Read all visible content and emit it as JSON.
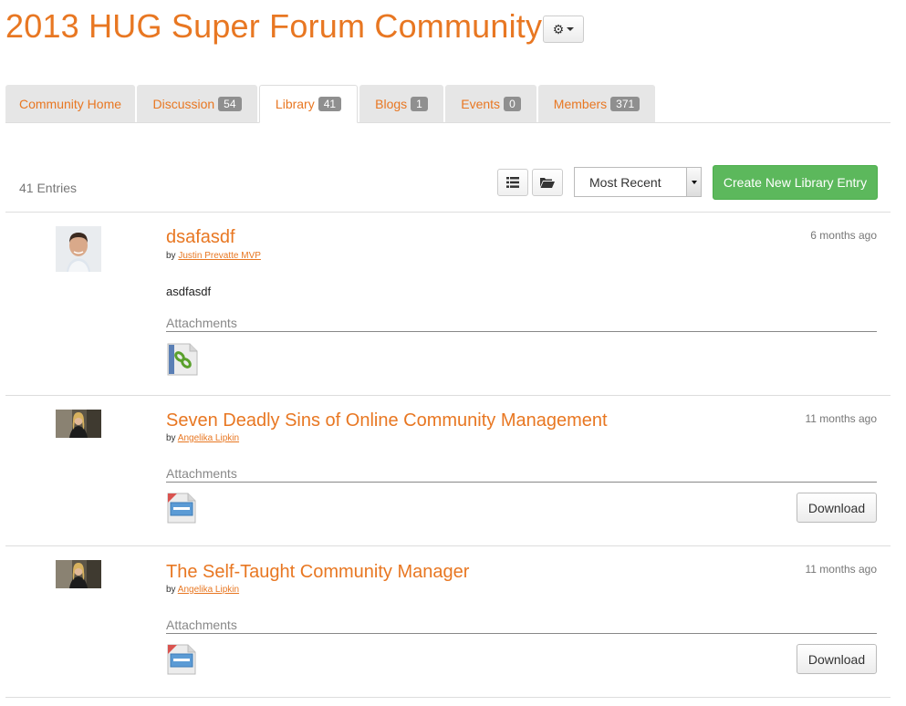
{
  "header": {
    "title": "2013 HUG Super Forum Community",
    "gear_icon": "⚙"
  },
  "tabs": [
    {
      "label": "Community Home",
      "count": null
    },
    {
      "label": "Discussion",
      "count": "54"
    },
    {
      "label": "Library",
      "count": "41",
      "active": true
    },
    {
      "label": "Blogs",
      "count": "1"
    },
    {
      "label": "Events",
      "count": "0"
    },
    {
      "label": "Members",
      "count": "371"
    }
  ],
  "toolbar": {
    "entries_count": "41 Entries",
    "sort_value": "Most Recent",
    "create_label": "Create New Library Entry"
  },
  "entries": [
    {
      "title": "dsafasdf",
      "by": "by",
      "author": "Justin Prevatte MVP",
      "time": "6 months ago",
      "body": "asdfasdf",
      "attachments_label": "Attachments",
      "attachment_icon": "link-file-icon"
    },
    {
      "title": "Seven Deadly Sins of Online Community Management",
      "by": "by",
      "author": "Angelika Lipkin",
      "time": "11 months ago",
      "attachments_label": "Attachments",
      "attachment_icon": "webinar-file-icon",
      "download_label": "Download"
    },
    {
      "title": "The Self-Taught Community Manager",
      "by": "by",
      "author": "Angelika Lipkin",
      "time": "11 months ago",
      "attachments_label": "Attachments",
      "attachment_icon": "webinar-file-icon",
      "download_label": "Download"
    }
  ],
  "colors": {
    "accent": "#e87722",
    "create_button": "#5cb85c",
    "badge": "#8f8f8f"
  }
}
